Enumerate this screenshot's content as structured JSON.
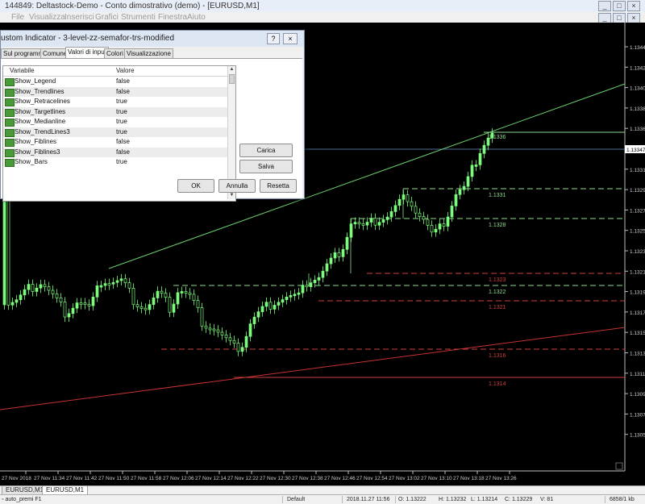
{
  "window": {
    "title": "144849: Deltastock-Demo - Conto dimostrativo (demo) - [EURUSD,M1]",
    "controls": [
      "_",
      "□",
      "×"
    ]
  },
  "menu": [
    "File",
    "Visualizza",
    "Inserisci",
    "Grafici",
    "Strumenti",
    "Finestra",
    "Aiuto"
  ],
  "dialog": {
    "title": "ustom Indicator - 3-level-zz-semafor-trs-modified",
    "help": "?",
    "close": "×",
    "tabs": [
      "Sul programma",
      "Comune",
      "Valori di input",
      "Colori",
      "Visualizzazione"
    ],
    "active_tab": "Valori di input",
    "col_variable": "Variabile",
    "col_value": "Valore",
    "params": [
      {
        "name": "Show_Legend",
        "value": "false"
      },
      {
        "name": "Show_Trendlines",
        "value": "false"
      },
      {
        "name": "Show_Retracelines",
        "value": "true"
      },
      {
        "name": "Show_Targetlines",
        "value": "true"
      },
      {
        "name": "Show_Medianline",
        "value": "true"
      },
      {
        "name": "Show_TrendLines3",
        "value": "true"
      },
      {
        "name": "Show_Fiblines",
        "value": "false"
      },
      {
        "name": "Show_Fiblines3",
        "value": "false"
      },
      {
        "name": "Show_Bars",
        "value": "true"
      }
    ],
    "buttons": {
      "carica": "Carica",
      "salva": "Salva",
      "ok": "OK",
      "annulla": "Annulla",
      "resetta": "Resetta"
    }
  },
  "chart": {
    "symbol_tabs": [
      "EURUSD,M1",
      "EURUSD,M1"
    ],
    "current_price": "1.13347",
    "price_labels": [
      "1.13440",
      "1.13420",
      "1.13405",
      "1.13385",
      "1.13365",
      "1.13330",
      "1.13310",
      "1.13290",
      "1.13275",
      "1.13255",
      "1.13235",
      "1.13215",
      "1.13195",
      "1.13175",
      "1.13155",
      "1.13135",
      "1.13115",
      "1.13095",
      "1.13075",
      "1.13055"
    ],
    "time_labels": [
      "27 Nov 2018",
      "27 Nov 11:34",
      "27 Nov 11:42",
      "27 Nov 11:50",
      "27 Nov 11:58",
      "27 Nov 12:06",
      "27 Nov 12:14",
      "27 Nov 12:22",
      "27 Nov 12:30",
      "27 Nov 12:38",
      "27 Nov 12:46",
      "27 Nov 12:54",
      "27 Nov 13:02",
      "27 Nov 13:10",
      "27 Nov 13:18",
      "27 Nov 13:26"
    ],
    "level_labels": [
      "1.1336",
      "1.1331",
      "1.1328",
      "1.1323",
      "1.1322",
      "1.1321",
      "1.1316",
      "1.1314"
    ],
    "colors": {
      "bull": "#7cfc7c",
      "level_green": "#8fdc8f",
      "level_red": "#d04040",
      "trend_green": "#6ccf6c",
      "trend_red": "#c83232"
    }
  },
  "status": {
    "file": "auto_premi F1",
    "profile": "Default",
    "datetime": "2018.11.27 11:56",
    "open": "O: 1.13222",
    "high": "H: 1.13232",
    "low": "L: 1.13214",
    "close": "C: 1.13229",
    "volume": "V: 81",
    "traffic": "6858/1 kb"
  }
}
